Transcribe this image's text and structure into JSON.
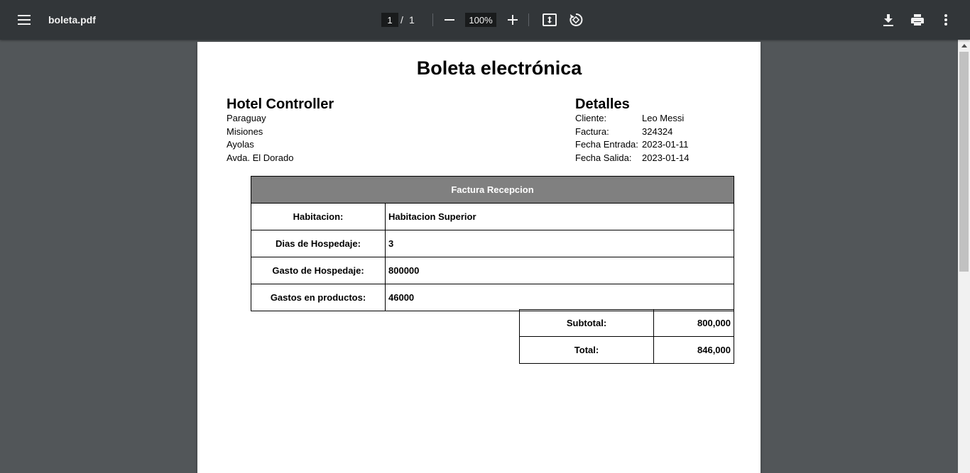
{
  "viewer": {
    "file_name": "boleta.pdf",
    "current_page": "1",
    "page_separator": "/",
    "total_pages": "1",
    "zoom": "100%"
  },
  "document": {
    "title": "Boleta electrónica",
    "company": {
      "name": "Hotel Controller",
      "address_lines": [
        "Paraguay",
        "Misiones",
        "Ayolas",
        "Avda. El Dorado"
      ]
    },
    "details": {
      "heading": "Detalles",
      "rows": [
        {
          "label": "Cliente:",
          "value": "Leo Messi"
        },
        {
          "label": "Factura:",
          "value": "324324"
        },
        {
          "label": "Fecha Entrada:",
          "value": "2023-01-11"
        },
        {
          "label": "Fecha Salida:",
          "value": "2023-01-14"
        }
      ]
    },
    "table": {
      "header": "Factura Recepcion",
      "rows": [
        {
          "label": "Habitacion:",
          "value": "Habitacion Superior"
        },
        {
          "label": "Dias de Hospedaje:",
          "value": "3"
        },
        {
          "label": "Gasto de Hospedaje:",
          "value": "800000"
        },
        {
          "label": "Gastos en productos:",
          "value": "46000"
        }
      ]
    },
    "totals": [
      {
        "label": "Subtotal:",
        "value": "800,000"
      },
      {
        "label": "Total:",
        "value": "846,000"
      }
    ]
  },
  "icons": [
    "menu-icon",
    "zoom-out-icon",
    "zoom-in-icon",
    "fit-page-icon",
    "rotate-icon",
    "download-icon",
    "print-icon",
    "more-vert-icon"
  ]
}
